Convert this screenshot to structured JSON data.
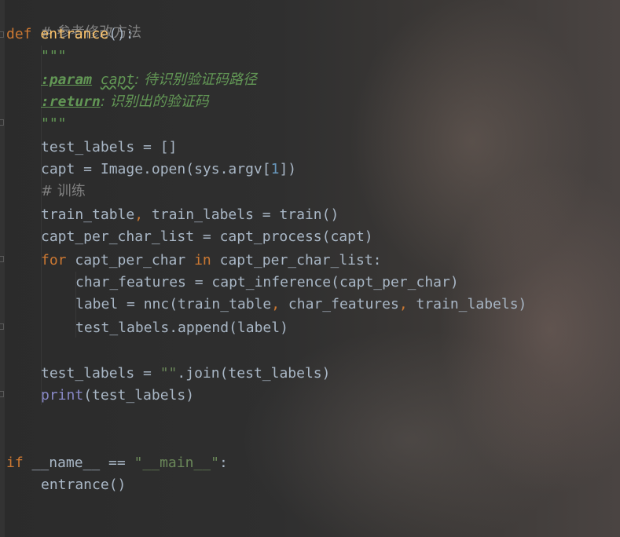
{
  "code": {
    "l1_comment": "# 参考修改方法",
    "l2_kw": "def",
    "l2_fn": "entrance",
    "l2_rest": "():",
    "l3_doc": "\"\"\"",
    "l4_tag": ":param",
    "l4_param": "capt",
    "l4_text": ": 待识别验证码路径",
    "l5_tag": ":return",
    "l5_text": ": 识别出的验证码",
    "l6_doc": "\"\"\"",
    "l7": "test_labels = []",
    "l8_a": "capt = Image.open(sys.argv[",
    "l8_num": "1",
    "l8_b": "])",
    "l9_comment": "# 训练",
    "l10_a": "train_table",
    "l10_comma": ",",
    "l10_b": " train_labels = train()",
    "l11": "capt_per_char_list = capt_process(capt)",
    "l12_kw1": "for",
    "l12_a": " capt_per_char ",
    "l12_kw2": "in",
    "l12_b": " capt_per_char_list:",
    "l13": "char_features = capt_inference(capt_per_char)",
    "l14_a": "label = nnc(train_table",
    "l14_c1": ",",
    "l14_b": " char_features",
    "l14_c2": ",",
    "l14_c": " train_labels)",
    "l15": "test_labels.append(label)",
    "l16_a": "test_labels = ",
    "l16_str": "\"\"",
    "l16_b": ".join(test_labels)",
    "l17_builtin": "print",
    "l17_rest": "(test_labels)",
    "l18_kw": "if",
    "l18_a": " __name__ == ",
    "l18_str": "\"__main__\"",
    "l18_b": ":",
    "l19": "entrance()"
  }
}
